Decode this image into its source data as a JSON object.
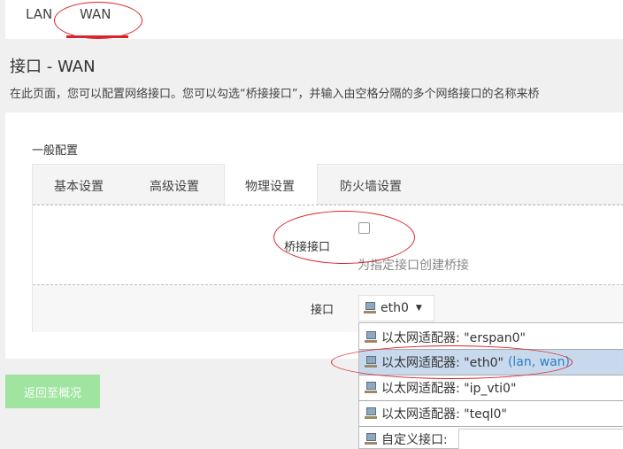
{
  "top_tabs": {
    "lan": "LAN",
    "wan": "WAN"
  },
  "page": {
    "title": "接口 - WAN",
    "description": "在此页面，您可以配置网络接口。您可以勾选“桥接接口”，并输入由空格分隔的多个网络接口的名称来桥"
  },
  "section": {
    "label": "一般配置"
  },
  "subtabs": [
    "基本设置",
    "高级设置",
    "物理设置",
    "防火墙设置"
  ],
  "bridge": {
    "label": "桥接接口",
    "hint": "为指定接口创建桥接"
  },
  "interface": {
    "label": "接口",
    "selected": "eth0"
  },
  "dropdown": {
    "items": [
      {
        "label": "以太网适配器: \"erspan0\"",
        "extra": ""
      },
      {
        "label": "以太网适配器: \"eth0\"",
        "extra": "(lan, wan)"
      },
      {
        "label": "以太网适配器: \"ip_vti0\"",
        "extra": ""
      },
      {
        "label": "以太网适配器: \"teql0\"",
        "extra": ""
      }
    ],
    "custom_label": "自定义接口:"
  },
  "back_button": "返回至概况",
  "colors": {
    "accent_red": "#d9242c",
    "button_green": "#9fe49f",
    "selected_row": "#c8d9ed"
  },
  "icons": {
    "network": "network-adapter-icon",
    "arrow": "dropdown-arrow-icon"
  }
}
